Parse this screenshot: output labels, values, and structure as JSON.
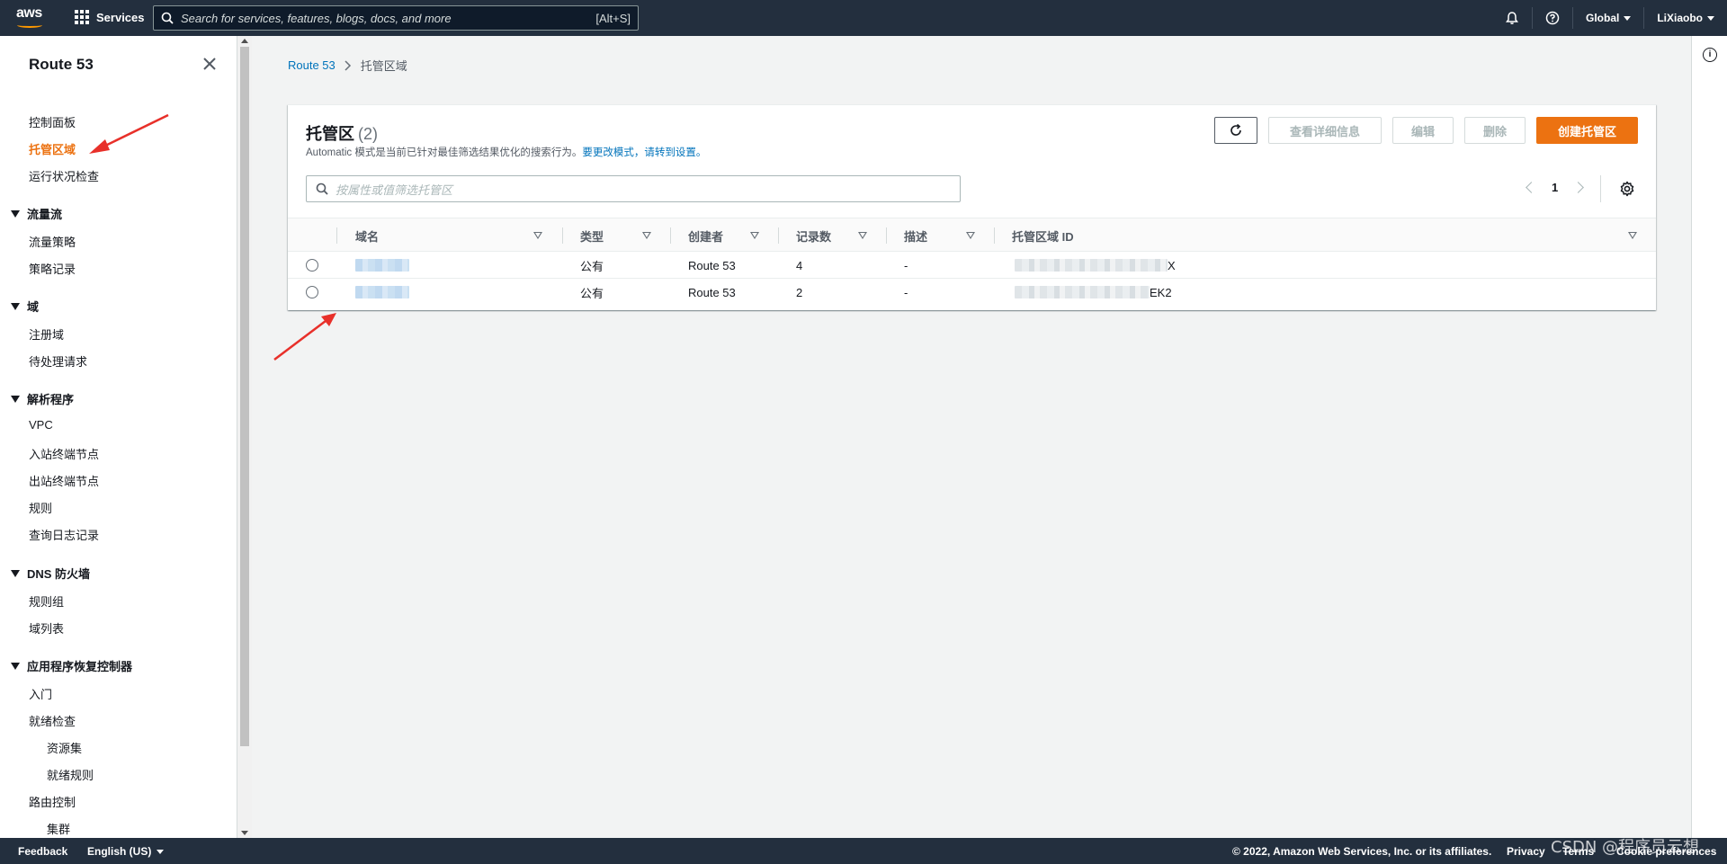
{
  "topnav": {
    "logo_text": "aws",
    "services_label": "Services",
    "search_placeholder": "Search for services, features, blogs, docs, and more",
    "search_shortcut": "[Alt+S]",
    "region_label": "Global",
    "user_label": "LiXiaobo"
  },
  "sidebar": {
    "title": "Route 53",
    "items": [
      {
        "label": "控制面板"
      },
      {
        "label": "托管区域"
      },
      {
        "label": "运行状况检查"
      }
    ],
    "sections": [
      {
        "label": "流量流",
        "items": [
          "流量策略",
          "策略记录"
        ]
      },
      {
        "label": "域",
        "items": [
          "注册域",
          "待处理请求"
        ]
      },
      {
        "label": "解析程序",
        "items": [
          "VPC",
          "入站终端节点",
          "出站终端节点",
          "规则",
          "查询日志记录"
        ]
      },
      {
        "label": "DNS 防火墙",
        "items": [
          "规则组",
          "域列表"
        ]
      },
      {
        "label": "应用程序恢复控制器",
        "items": [
          "入门",
          "就绪检查",
          "资源集",
          "就绪规则",
          "路由控制",
          "集群"
        ]
      }
    ]
  },
  "breadcrumb": {
    "root": "Route 53",
    "current": "托管区域"
  },
  "panel": {
    "title": "托管区",
    "count": "(2)",
    "desc_prefix": "Automatic 模式是当前已针对最佳筛选结果优化的搜索行为。",
    "desc_link1": "要更改模式",
    "desc_link2": "，请转到设置。",
    "buttons": {
      "details": "查看详细信息",
      "edit": "编辑",
      "delete": "删除",
      "create": "创建托管区"
    },
    "filter_placeholder": "按属性或值筛选托管区",
    "page_number": "1"
  },
  "table": {
    "headers": [
      "域名",
      "类型",
      "创建者",
      "记录数",
      "描述",
      "托管区域 ID"
    ],
    "rows": [
      {
        "type": "公有",
        "creator": "Route 53",
        "records": "4",
        "desc": "-",
        "id_suffix": "X"
      },
      {
        "type": "公有",
        "creator": "Route 53",
        "records": "2",
        "desc": "-",
        "id_suffix": "EK2"
      }
    ]
  },
  "footer": {
    "feedback": "Feedback",
    "language": "English (US)",
    "copyright": "© 2022, Amazon Web Services, Inc. or its affiliates.",
    "privacy": "Privacy",
    "terms": "Terms",
    "cookies": "Cookie preferences",
    "watermark": "CSDN @程序员云想"
  },
  "colors": {
    "nav_bg": "#232f3e",
    "accent": "#ec7211",
    "link": "#0073bb",
    "annotation": "#e8302a"
  }
}
